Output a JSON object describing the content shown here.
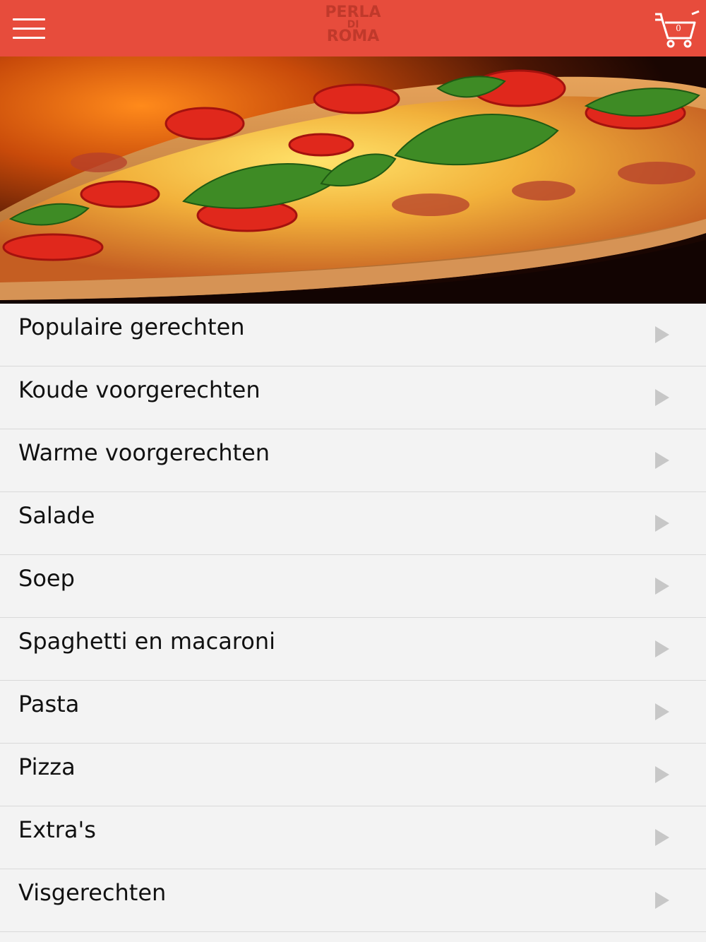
{
  "header": {
    "logo_line1": "PERLA",
    "logo_line2": "DI",
    "logo_line3": "ROMA",
    "cart_count": "0",
    "colors": {
      "bar": "#e74c3c",
      "logo": "#c0392b"
    },
    "menu_icon": "hamburger-icon",
    "cart_icon": "cart-icon"
  },
  "hero": {
    "image": "pizza-hero-image"
  },
  "menu": {
    "arrow_icon": "chevron-right-icon",
    "items": [
      {
        "label": "Populaire gerechten"
      },
      {
        "label": "Koude voorgerechten"
      },
      {
        "label": "Warme voorgerechten"
      },
      {
        "label": "Salade"
      },
      {
        "label": "Soep"
      },
      {
        "label": "Spaghetti en macaroni"
      },
      {
        "label": "Pasta"
      },
      {
        "label": "Pizza"
      },
      {
        "label": "Extra's"
      },
      {
        "label": "Visgerechten"
      }
    ]
  }
}
